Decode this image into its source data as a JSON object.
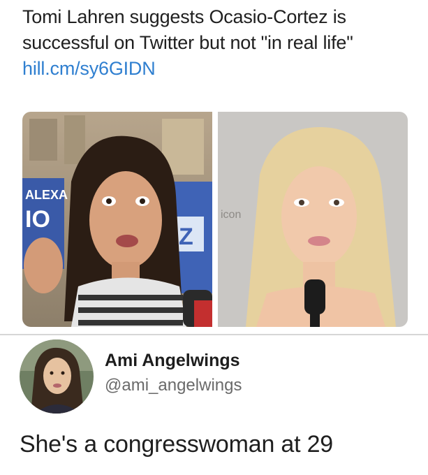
{
  "tweet": {
    "text": "Tomi Lahren suggests Ocasio-Cortez is successful on Twitter but not \"in real life\" ",
    "link": "hill.cm/sy6GIDN",
    "photos": [
      {
        "icon": "person-photo-left",
        "sign_text_1": "ALEXA",
        "sign_text_2": "IO",
        "sign_text_3": "Z"
      },
      {
        "icon": "person-photo-right",
        "backdrop_text": "icon"
      }
    ]
  },
  "reply": {
    "display_name": "Ami Angelwings",
    "handle": "@ami_angelwings",
    "text": "She's a congresswoman at 29"
  },
  "colors": {
    "link": "#2f7fd0",
    "text": "#202020",
    "handle": "#6a6a6a"
  }
}
